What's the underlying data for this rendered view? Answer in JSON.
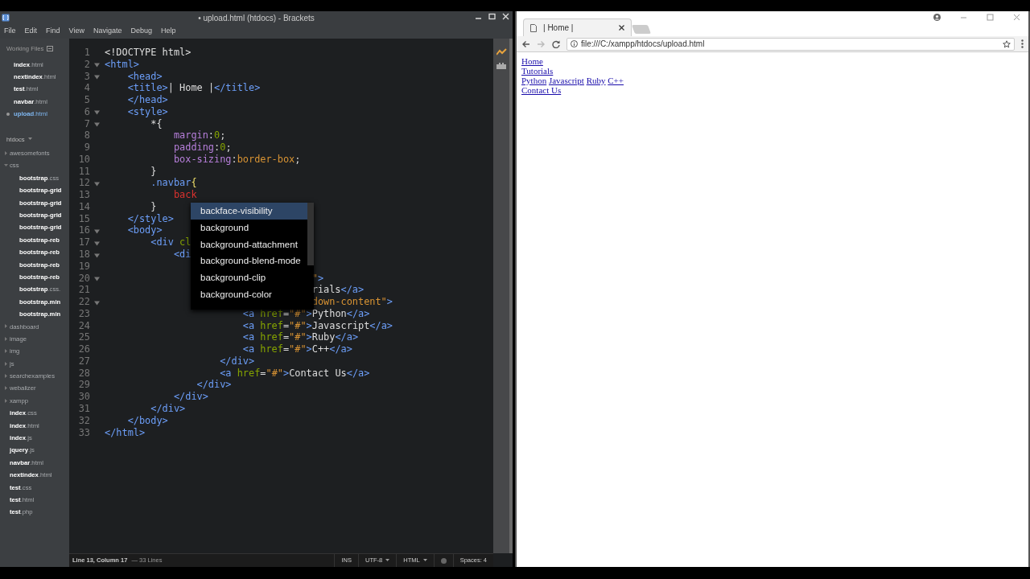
{
  "editor": {
    "title": "• upload.html (htdocs) - Brackets",
    "menu": [
      "File",
      "Edit",
      "Find",
      "View",
      "Navigate",
      "Debug",
      "Help"
    ],
    "working_files": {
      "label": "Working Files",
      "files": [
        {
          "name": "**index**.html",
          "selected": false
        },
        {
          "name": "**nextindex**.html",
          "selected": false
        },
        {
          "name": "**test**.html",
          "selected": false
        },
        {
          "name": "**navbar**.html",
          "selected": false
        },
        {
          "name": "**upload**.html",
          "selected": true
        }
      ]
    },
    "project": {
      "name": "htdocs",
      "items": [
        {
          "kind": "folder",
          "name": "awesomefonts",
          "expanded": false
        },
        {
          "kind": "folder",
          "name": "css",
          "expanded": true,
          "children": [
            {
              "kind": "file",
              "name": "**bootstrap**.css"
            },
            {
              "kind": "file",
              "name": "**bootstrap-grid**"
            },
            {
              "kind": "file",
              "name": "**bootstrap-grid**"
            },
            {
              "kind": "file",
              "name": "**bootstrap-grid**"
            },
            {
              "kind": "file",
              "name": "**bootstrap-grid**"
            },
            {
              "kind": "file",
              "name": "**bootstrap-reb**"
            },
            {
              "kind": "file",
              "name": "**bootstrap-reb**"
            },
            {
              "kind": "file",
              "name": "**bootstrap-reb**"
            },
            {
              "kind": "file",
              "name": "**bootstrap-reb**"
            },
            {
              "kind": "file",
              "name": "**bootstrap**.css."
            },
            {
              "kind": "file",
              "name": "**bootstrap.min**"
            },
            {
              "kind": "file",
              "name": "**bootstrap.min**"
            }
          ]
        },
        {
          "kind": "folder",
          "name": "dashboard",
          "expanded": false
        },
        {
          "kind": "folder",
          "name": "image",
          "expanded": false
        },
        {
          "kind": "folder",
          "name": "img",
          "expanded": false
        },
        {
          "kind": "folder",
          "name": "js",
          "expanded": false
        },
        {
          "kind": "folder",
          "name": "searchexamples",
          "expanded": false
        },
        {
          "kind": "folder",
          "name": "webalizer",
          "expanded": false
        },
        {
          "kind": "folder",
          "name": "xampp",
          "expanded": false
        },
        {
          "kind": "file",
          "name": "**index**.css"
        },
        {
          "kind": "file",
          "name": "**index**.html"
        },
        {
          "kind": "file",
          "name": "**index**.js"
        },
        {
          "kind": "file",
          "name": "**jquery**.js"
        },
        {
          "kind": "file",
          "name": "**navbar**.html"
        },
        {
          "kind": "file",
          "name": "**nextindex**.html"
        },
        {
          "kind": "file",
          "name": "**test**.css"
        },
        {
          "kind": "file",
          "name": "**test**.html"
        },
        {
          "kind": "file",
          "name": "**test**.php"
        }
      ]
    },
    "code_lines": [
      {
        "number": "1",
        "fold": false,
        "tokens": [
          {
            "kind": "meta",
            "text": "<!DOCTYPE html>"
          }
        ]
      },
      {
        "number": "2",
        "fold": true,
        "tokens": [
          {
            "kind": "tag",
            "text": "<html>"
          }
        ]
      },
      {
        "number": "3",
        "fold": true,
        "tokens": [
          {
            "kind": "tag",
            "text": "    <head>"
          }
        ]
      },
      {
        "number": "4",
        "fold": false,
        "tokens": [
          {
            "kind": "tag",
            "text": "    <title>"
          },
          {
            "kind": "text",
            "text": "| Home |"
          },
          {
            "kind": "tag",
            "text": "</title>"
          }
        ]
      },
      {
        "number": "5",
        "fold": false,
        "tokens": [
          {
            "kind": "tag",
            "text": "    </head>"
          }
        ]
      },
      {
        "number": "6",
        "fold": true,
        "tokens": [
          {
            "kind": "tag",
            "text": "    <style>"
          }
        ]
      },
      {
        "number": "7",
        "fold": true,
        "tokens": [
          {
            "kind": "text",
            "text": "        *{"
          }
        ]
      },
      {
        "number": "8",
        "fold": false,
        "tokens": [
          {
            "kind": "prop",
            "text": "            margin"
          },
          {
            "kind": "text",
            "text": ":"
          },
          {
            "kind": "num",
            "text": "0"
          },
          {
            "kind": "text",
            "text": ";"
          }
        ]
      },
      {
        "number": "9",
        "fold": false,
        "tokens": [
          {
            "kind": "prop",
            "text": "            padding"
          },
          {
            "kind": "text",
            "text": ":"
          },
          {
            "kind": "num",
            "text": "0"
          },
          {
            "kind": "text",
            "text": ";"
          }
        ]
      },
      {
        "number": "10",
        "fold": false,
        "tokens": [
          {
            "kind": "prop",
            "text": "            box-sizing"
          },
          {
            "kind": "text",
            "text": ":"
          },
          {
            "kind": "value",
            "text": "border-box"
          },
          {
            "kind": "text",
            "text": ";"
          }
        ]
      },
      {
        "number": "11",
        "fold": false,
        "tokens": [
          {
            "kind": "text",
            "text": "        }"
          }
        ]
      },
      {
        "number": "12",
        "fold": true,
        "tokens": [
          {
            "kind": "tag",
            "text": "        .navbar"
          },
          {
            "kind": "brace",
            "text": "{"
          }
        ]
      },
      {
        "number": "13",
        "fold": false,
        "tokens": [
          {
            "kind": "error",
            "text": "            back"
          }
        ]
      },
      {
        "number": "14",
        "fold": false,
        "tokens": [
          {
            "kind": "text",
            "text": "        }"
          }
        ]
      },
      {
        "number": "15",
        "fold": false,
        "tokens": [
          {
            "kind": "tag",
            "text": "    </style>"
          }
        ]
      },
      {
        "number": "16",
        "fold": true,
        "tokens": [
          {
            "kind": "tag",
            "text": "    <body>"
          }
        ]
      },
      {
        "number": "17",
        "fold": true,
        "tokens": [
          {
            "kind": "tag",
            "text": "        <div"
          },
          {
            "kind": "attr",
            "text": " cl"
          }
        ]
      },
      {
        "number": "18",
        "fold": true,
        "tokens": [
          {
            "kind": "tag",
            "text": "            <di"
          }
        ]
      },
      {
        "number": "19",
        "fold": false
      },
      {
        "number": "20",
        "fold": true,
        "tokens": [
          {
            "kind": "value",
            "text": "                                    \""
          },
          {
            "kind": "tag",
            "text": ">"
          }
        ]
      },
      {
        "number": "21",
        "fold": false,
        "tokens": [
          {
            "kind": "text",
            "text": "                                    rials"
          },
          {
            "kind": "tag",
            "text": "</a>"
          }
        ]
      },
      {
        "number": "22",
        "fold": true,
        "tokens": [
          {
            "kind": "value",
            "text": "                                    down-content\""
          },
          {
            "kind": "tag",
            "text": ">"
          }
        ]
      },
      {
        "number": "23",
        "fold": false,
        "tokens": [
          {
            "kind": "tag",
            "text": "                        <a"
          },
          {
            "kind": "attr",
            "text": " href"
          },
          {
            "kind": "text",
            "text": "="
          },
          {
            "kind": "value",
            "text": "\"#\""
          },
          {
            "kind": "tag",
            "text": ">"
          },
          {
            "kind": "text",
            "text": "Python"
          },
          {
            "kind": "tag",
            "text": "</a>"
          }
        ]
      },
      {
        "number": "24",
        "fold": false,
        "tokens": [
          {
            "kind": "tag",
            "text": "                        <a"
          },
          {
            "kind": "attr",
            "text": " href"
          },
          {
            "kind": "text",
            "text": "="
          },
          {
            "kind": "value",
            "text": "\"#\""
          },
          {
            "kind": "tag",
            "text": ">"
          },
          {
            "kind": "text",
            "text": "Javascript"
          },
          {
            "kind": "tag",
            "text": "</a>"
          }
        ]
      },
      {
        "number": "25",
        "fold": false,
        "tokens": [
          {
            "kind": "tag",
            "text": "                        <a"
          },
          {
            "kind": "attr",
            "text": " href"
          },
          {
            "kind": "text",
            "text": "="
          },
          {
            "kind": "value",
            "text": "\"#\""
          },
          {
            "kind": "tag",
            "text": ">"
          },
          {
            "kind": "text",
            "text": "Ruby"
          },
          {
            "kind": "tag",
            "text": "</a>"
          }
        ]
      },
      {
        "number": "26",
        "fold": false,
        "tokens": [
          {
            "kind": "tag",
            "text": "                        <a"
          },
          {
            "kind": "attr",
            "text": " href"
          },
          {
            "kind": "text",
            "text": "="
          },
          {
            "kind": "value",
            "text": "\"#\""
          },
          {
            "kind": "tag",
            "text": ">"
          },
          {
            "kind": "text",
            "text": "C++"
          },
          {
            "kind": "tag",
            "text": "</a>"
          }
        ]
      },
      {
        "number": "27",
        "fold": false,
        "tokens": [
          {
            "kind": "tag",
            "text": "                    </div>"
          }
        ]
      },
      {
        "number": "28",
        "fold": false,
        "tokens": [
          {
            "kind": "tag",
            "text": "                    <a"
          },
          {
            "kind": "attr",
            "text": " href"
          },
          {
            "kind": "text",
            "text": "="
          },
          {
            "kind": "value",
            "text": "\"#\""
          },
          {
            "kind": "tag",
            "text": ">"
          },
          {
            "kind": "text",
            "text": "Contact Us"
          },
          {
            "kind": "tag",
            "text": "</a>"
          }
        ]
      },
      {
        "number": "29",
        "fold": false,
        "tokens": [
          {
            "kind": "tag",
            "text": "                </div>"
          }
        ]
      },
      {
        "number": "30",
        "fold": false,
        "tokens": [
          {
            "kind": "tag",
            "text": "            </div>"
          }
        ]
      },
      {
        "number": "31",
        "fold": false,
        "tokens": [
          {
            "kind": "tag",
            "text": "        </div>"
          }
        ]
      },
      {
        "number": "32",
        "fold": false,
        "tokens": [
          {
            "kind": "tag",
            "text": "    </body>"
          }
        ]
      },
      {
        "number": "33",
        "fold": false,
        "tokens": [
          {
            "kind": "tag",
            "text": "</html>"
          }
        ]
      }
    ],
    "hints": [
      {
        "label": "backface-visibility",
        "selected": true
      },
      {
        "label": "background",
        "selected": false
      },
      {
        "label": "background-attachment",
        "selected": false
      },
      {
        "label": "background-blend-mode",
        "selected": false
      },
      {
        "label": "background-clip",
        "selected": false
      },
      {
        "label": "background-color",
        "selected": false
      }
    ],
    "status_bar": {
      "position": "Line 13, Column 17",
      "line_count": "— 33 Lines",
      "mode": "INS",
      "encoding": "UTF-8",
      "language": "HTML",
      "indent": "Spaces: 4"
    }
  },
  "browser": {
    "tab": {
      "title": "| Home |"
    },
    "address": "file:///C:/xampp/htdocs/upload.html",
    "link_lines": [
      [
        "Home"
      ],
      [
        "Tutorials"
      ],
      [
        "Python",
        "Javascript",
        "Ruby",
        "C++"
      ],
      [
        "Contact Us"
      ]
    ]
  }
}
